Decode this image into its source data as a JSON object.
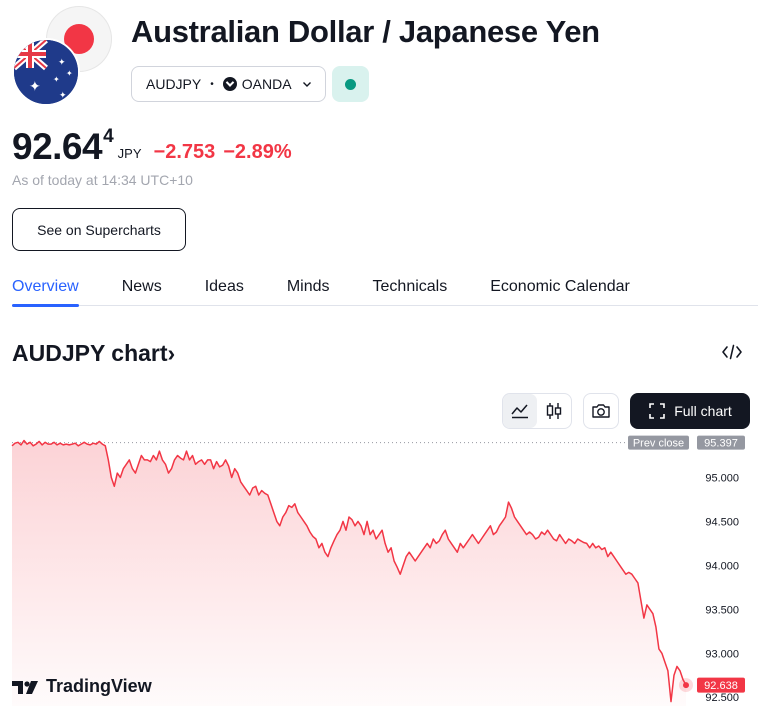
{
  "header": {
    "title": "Australian Dollar / Japanese Yen",
    "symbol": "AUDJPY",
    "broker": "OANDA",
    "status_color": "#089981"
  },
  "quote": {
    "price_main": "92.64",
    "price_sup": "4",
    "currency": "JPY",
    "change": "−2.753",
    "change_pct": "−2.89%",
    "as_of": "As of today at 14:34 UTC+10",
    "change_color": "#f23645"
  },
  "actions": {
    "see_on_supercharts": "See on Supercharts",
    "full_chart": "Full chart"
  },
  "tabs": [
    {
      "label": "Overview",
      "active": true
    },
    {
      "label": "News",
      "active": false
    },
    {
      "label": "Ideas",
      "active": false
    },
    {
      "label": "Minds",
      "active": false
    },
    {
      "label": "Technicals",
      "active": false
    },
    {
      "label": "Economic Calendar",
      "active": false
    }
  ],
  "chart_section": {
    "heading": "AUDJPY chart",
    "heading_chevron": "›",
    "watermark": "TradingView"
  },
  "icons": {
    "flag_base": "japan-flag-icon",
    "flag_quote": "australia-flag-icon",
    "broker": "oanda-logo-icon",
    "embed": "code-embed-icon",
    "area_chart": "area-chart-icon",
    "candle_chart": "candlestick-chart-icon",
    "snapshot": "camera-icon",
    "full_chart": "expand-icon",
    "watermark": "tradingview-logo-icon"
  },
  "chart_data": {
    "type": "area",
    "title": "",
    "xlabel": "",
    "ylabel": "",
    "ylim": [
      92.4,
      95.54
    ],
    "y_ticks": [
      "95.000",
      "94.500",
      "94.000",
      "93.500",
      "93.000",
      "92.500"
    ],
    "prev_close": {
      "label": "Prev close",
      "value": 95.397,
      "text": "95.397"
    },
    "last": {
      "value": 92.638,
      "text": "92.638"
    },
    "line_color": "#f23645",
    "grid": false,
    "series": [
      {
        "values": [
          95.36,
          95.39,
          95.4,
          95.37,
          95.42,
          95.38,
          95.4,
          95.36,
          95.38,
          95.41,
          95.37,
          95.4,
          95.38,
          95.38,
          95.4,
          95.37,
          95.39,
          95.37,
          95.38,
          95.37,
          95.38,
          95.39,
          95.36,
          95.38,
          95.4,
          95.38,
          95.37,
          95.39,
          95.38,
          95.41,
          95.38,
          95.36,
          95.2,
          95.0,
          94.9,
          95.05,
          95.0,
          95.1,
          95.15,
          95.2,
          95.1,
          95.05,
          95.15,
          95.25,
          95.2,
          95.2,
          95.18,
          95.25,
          95.2,
          95.3,
          95.2,
          95.15,
          95.05,
          95.1,
          95.2,
          95.25,
          95.22,
          95.2,
          95.3,
          95.2,
          95.25,
          95.15,
          95.18,
          95.2,
          95.15,
          95.2,
          95.2,
          95.1,
          95.18,
          95.12,
          95.14,
          95.2,
          95.13,
          95.0,
          95.1,
          95.05,
          94.95,
          94.9,
          94.85,
          94.8,
          94.88,
          94.9,
          94.8,
          94.85,
          94.82,
          94.8,
          94.7,
          94.6,
          94.5,
          94.45,
          94.55,
          94.6,
          94.68,
          94.66,
          94.7,
          94.6,
          94.55,
          94.5,
          94.45,
          94.38,
          94.33,
          94.3,
          94.2,
          94.25,
          94.15,
          94.1,
          94.2,
          94.28,
          94.35,
          94.4,
          94.5,
          94.4,
          94.55,
          94.52,
          94.45,
          94.5,
          94.45,
          94.35,
          94.5,
          94.35,
          94.4,
          94.3,
          94.35,
          94.4,
          94.25,
          94.15,
          94.2,
          94.05,
          93.98,
          93.9,
          94.0,
          94.1,
          94.15,
          94.1,
          94.05,
          94.1,
          94.15,
          94.2,
          94.25,
          94.2,
          94.3,
          94.25,
          94.28,
          94.35,
          94.4,
          94.3,
          94.25,
          94.2,
          94.15,
          94.25,
          94.2,
          94.25,
          94.3,
          94.35,
          94.3,
          94.25,
          94.3,
          94.35,
          94.4,
          94.45,
          94.35,
          94.38,
          94.45,
          94.5,
          94.55,
          94.72,
          94.65,
          94.55,
          94.5,
          94.45,
          94.4,
          94.35,
          94.38,
          94.35,
          94.3,
          94.32,
          94.38,
          94.35,
          94.4,
          94.35,
          94.3,
          94.28,
          94.35,
          94.3,
          94.25,
          94.3,
          94.28,
          94.25,
          94.3,
          94.28,
          94.26,
          94.25,
          94.2,
          94.25,
          94.2,
          94.22,
          94.18,
          94.2,
          94.1,
          94.15,
          94.1,
          94.05,
          94.0,
          93.95,
          93.9,
          93.92,
          93.9,
          93.85,
          93.8,
          93.6,
          93.4,
          93.55,
          93.5,
          93.45,
          93.3,
          93.05,
          93.0,
          92.9,
          92.8,
          92.45,
          92.75,
          92.85,
          92.8,
          92.7,
          92.638
        ]
      }
    ]
  }
}
